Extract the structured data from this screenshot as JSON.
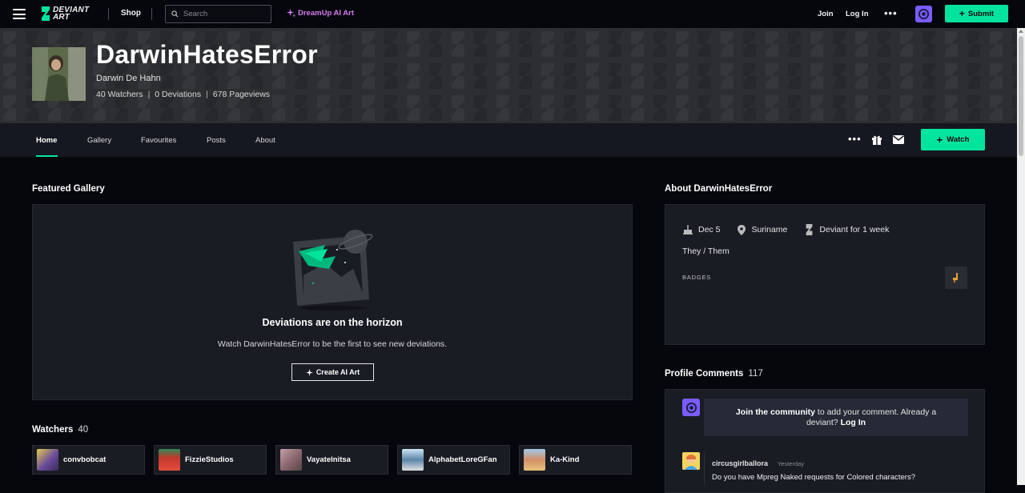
{
  "topbar": {
    "logo_line1": "DEVIANT",
    "logo_line2": "ART",
    "shop": "Shop",
    "search_placeholder": "Search",
    "dreamup": "DreamUp AI Art",
    "join": "Join",
    "login": "Log In",
    "more": "•••",
    "submit": "Submit",
    "accent": "#00e59b"
  },
  "profile": {
    "username": "DarwinHatesError",
    "realname": "Darwin De Hahn",
    "stats": [
      "40 Watchers",
      "0 Deviations",
      "678 Pageviews"
    ],
    "stat_sep": "|"
  },
  "nav": {
    "items": [
      "Home",
      "Gallery",
      "Favourites",
      "Posts",
      "About"
    ],
    "active": "Home",
    "more": "•••",
    "watch": "Watch"
  },
  "featured": {
    "title": "Featured Gallery",
    "empty_title": "Deviations are on the horizon",
    "empty_sub": "Watch DarwinHatesError to be the first to see new deviations.",
    "create_btn": "Create AI Art"
  },
  "watchers": {
    "title": "Watchers",
    "count": "40",
    "list": [
      {
        "name": "convbobcat",
        "color": "#6a4c9c"
      },
      {
        "name": "FizzieStudios",
        "color": "#c0392b"
      },
      {
        "name": "Vayatelnitsa",
        "color": "#8b6a70"
      },
      {
        "name": "AlphabetLoreGFan",
        "color": "#5b86a8"
      },
      {
        "name": "Ka-Kind",
        "color": "#d48f6a"
      }
    ]
  },
  "about": {
    "title": "About DarwinHatesError",
    "birthday": "Dec 5",
    "location": "Suriname",
    "member": "Deviant for 1 week",
    "pronouns": "They / Them",
    "badges_label": "BADGES"
  },
  "comments": {
    "title": "Profile Comments",
    "count": "117",
    "join_bold": "Join the community",
    "join_rest": " to add your comment. Already a deviant? ",
    "login": "Log In",
    "first": {
      "user": "circusgirlballora",
      "time": "Yesterday",
      "text": "Do you have Mpreg Naked requests for Colored characters?"
    }
  }
}
